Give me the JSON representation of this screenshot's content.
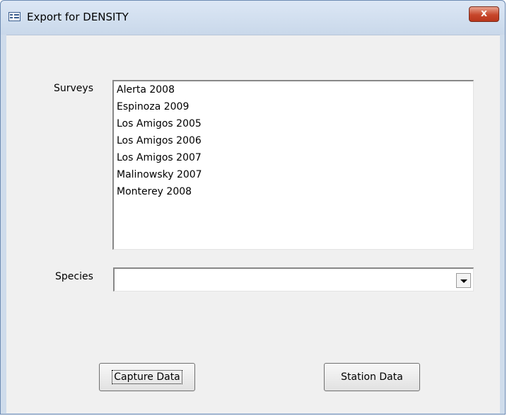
{
  "window": {
    "title": "Export for DENSITY",
    "close_glyph": "x"
  },
  "form": {
    "surveys_label": "Surveys",
    "surveys": [
      "Alerta 2008",
      "Espinoza 2009",
      "Los Amigos 2005",
      "Los Amigos 2006",
      "Los Amigos 2007",
      "Malinowsky 2007",
      "Monterey 2008"
    ],
    "species_label": "Species",
    "species_value": ""
  },
  "buttons": {
    "capture": "Capture Data",
    "station": "Station Data"
  },
  "icons": {
    "app": "form-window-icon",
    "close": "close-icon",
    "dropdown": "chevron-down-icon"
  }
}
